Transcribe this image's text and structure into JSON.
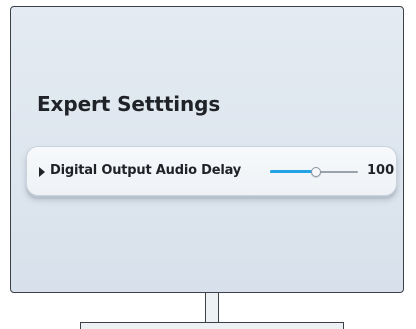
{
  "panel": {
    "title": "Expert Setttings"
  },
  "setting": {
    "label": "Digital Output Audio Delay",
    "value": "100",
    "slider_level": 0.52,
    "expand_icon": "triangle-right-icon"
  },
  "colors": {
    "accent": "#22a3e6",
    "text": "#1f2328",
    "screen_background": "#e0e7ef",
    "frame": "#3c4149"
  }
}
